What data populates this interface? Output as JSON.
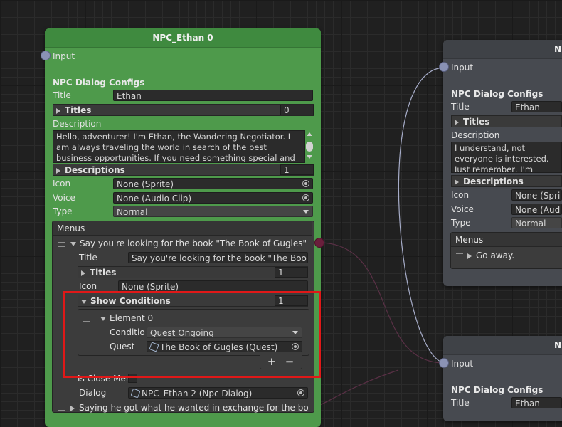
{
  "node_main": {
    "title": "NPC_Ethan 0",
    "input_label": "Input",
    "section_label": "NPC Dialog Configs",
    "title_label": "Title",
    "title_value": "Ethan",
    "titles_label": "Titles",
    "titles_count": "0",
    "description_label": "Description",
    "description_value": "Hello, adventurer! I'm Ethan, the Wandering Negotiator. I am always traveling the world in search of the best business opportunities. If you need something special and exclusive, I'm",
    "descriptions_label": "Descriptions",
    "descriptions_count": "1",
    "icon_label": "Icon",
    "icon_value": "None (Sprite)",
    "voice_label": "Voice",
    "voice_value": "None (Audio Clip)",
    "type_label": "Type",
    "type_value": "Normal",
    "menus_label": "Menus",
    "menu_item_1": {
      "label": "Say you're looking for the book \"The Book of Gugles\"",
      "title_label": "Title",
      "title_value": "Say you're looking for the book \"The Book of Gugles\"",
      "titles_label": "Titles",
      "titles_count": "1",
      "icon_label": "Icon",
      "icon_value": "None (Sprite)",
      "show_conditions_label": "Show Conditions",
      "show_conditions_count": "1",
      "element_label": "Element 0",
      "condition_label": "Condition",
      "condition_value": "Quest Ongoing",
      "quest_label": "Quest",
      "quest_value": "The Book of Gugles (Quest)",
      "add_symbol": "+",
      "remove_symbol": "−",
      "is_close_label": "Is Close Menu",
      "dialog_label": "Dialog",
      "dialog_value": "NPC_Ethan 2 (Npc Dialog)"
    },
    "menu_item_2_label": "Saying he got what he wanted in exchange for the book."
  },
  "node_right_top": {
    "title": "N",
    "input_label": "Input",
    "section_label": "NPC Dialog Configs",
    "title_label": "Title",
    "title_value": "Ethan",
    "titles_label": "Titles",
    "description_label": "Description",
    "description_value": "I understand, not everyone is interested. Just remember, I'm always here if you need a plethora of items and secrets",
    "descriptions_label": "Descriptions",
    "icon_label": "Icon",
    "icon_value": "None (Sprite)",
    "voice_label": "Voice",
    "voice_value": "None (Audio Clip)",
    "type_label": "Type",
    "type_value": "Normal",
    "menus_label": "Menus",
    "menu_item_label": "Go away."
  },
  "node_right_bottom": {
    "title": "N",
    "input_label": "Input",
    "section_label": "NPC Dialog Configs",
    "title_label": "Title",
    "title_value": "Ethan"
  },
  "colors": {
    "node_green": "#4e9a4b",
    "node_grey": "#474a50",
    "highlight_red": "#e01818",
    "port_input": "#8a92b4",
    "port_output": "#6a1f3c"
  }
}
